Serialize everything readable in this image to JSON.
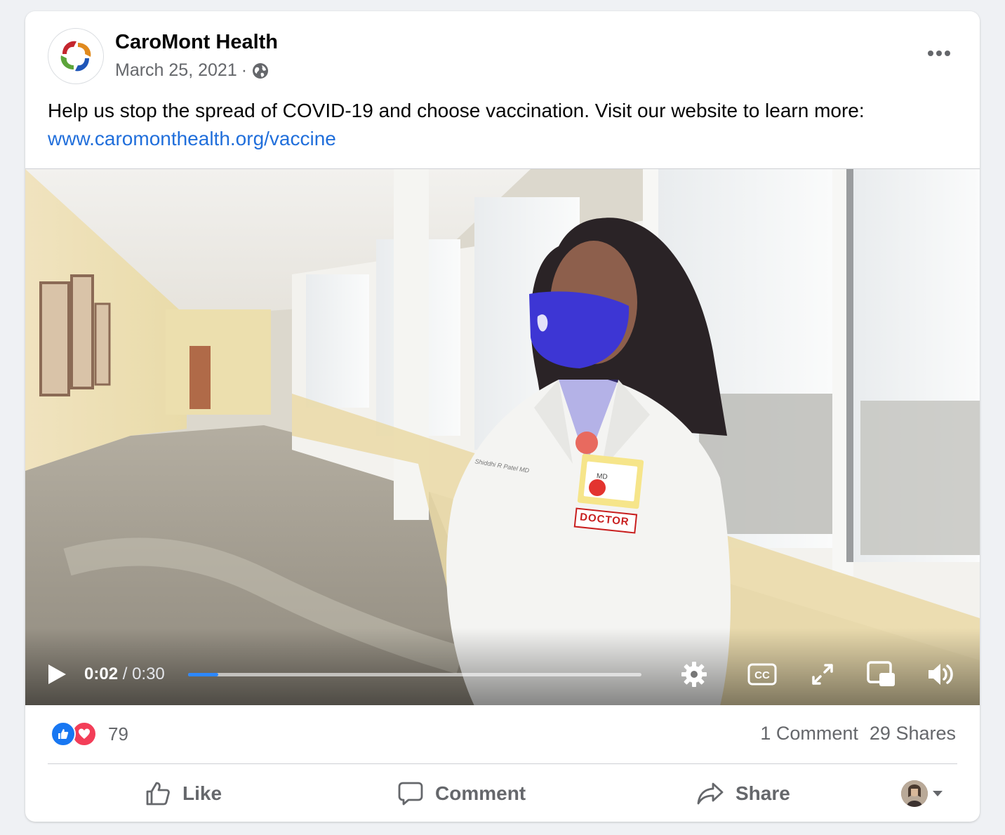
{
  "post": {
    "page_name": "CaroMont Health",
    "date": "March 25, 2021",
    "separator": "·",
    "audience_icon": "globe-icon",
    "more_icon": "more-options-icon",
    "text": "Help us stop the spread of COVID-19 and choose vaccination. Visit our website to learn more:",
    "link_text": "www.caromonthealth.org/vaccine"
  },
  "video": {
    "current_time": "0:02",
    "time_separator": " / ",
    "duration": "0:30",
    "progress_fraction": 0.067,
    "badge_line1": "MD",
    "badge_strip": "DOCTOR",
    "coat_name": "Shiddhi R Patel MD",
    "controls": [
      "play-icon",
      "settings-icon",
      "captions-icon",
      "fullscreen-icon",
      "picture-in-picture-icon",
      "volume-icon"
    ],
    "accent_color": "#2d88ff"
  },
  "engagement": {
    "reaction_count": "79",
    "comments": "1 Comment",
    "shares": "29 Shares",
    "reaction_colors": {
      "like": "#1877f2",
      "love": "#f33e58"
    }
  },
  "actions": {
    "like_label": "Like",
    "comment_label": "Comment",
    "share_label": "Share"
  },
  "colors": {
    "link": "#216fdb",
    "secondary_text": "#65676b",
    "page_background": "#eff1f4"
  }
}
